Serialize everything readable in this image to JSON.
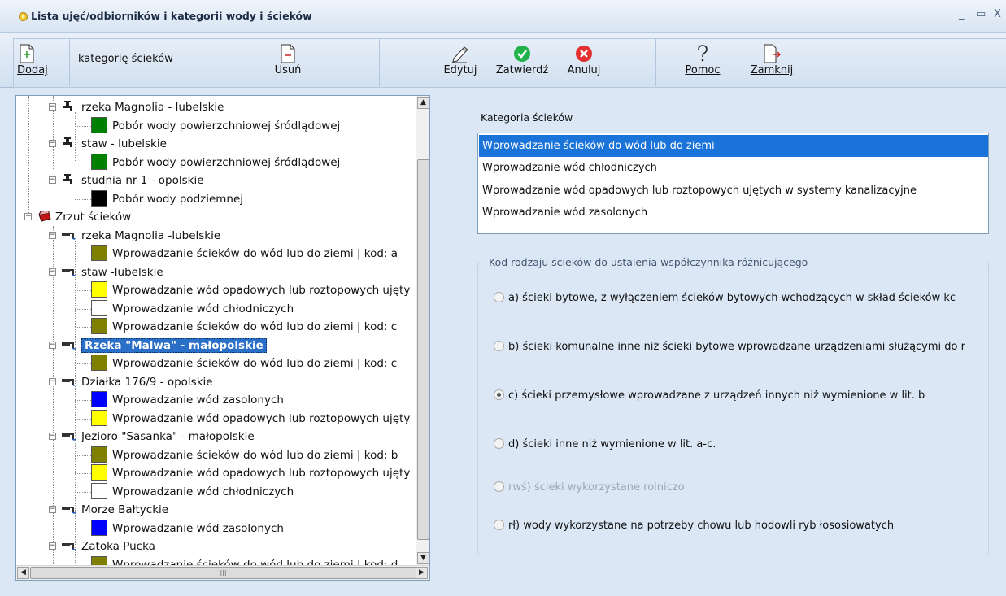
{
  "window": {
    "title": "Lista ujęć/odbiorników i kategorii wody i ścieków",
    "minimize": "_",
    "maximize": "▭",
    "close": "X"
  },
  "toolbar": {
    "add_label": "Dodaj",
    "add_hint": "kategorię ścieków",
    "delete_label": "Usuń",
    "edit_label": "Edytuj",
    "confirm_label": "Zatwierdź",
    "cancel_label": "Anuluj",
    "help_label": "Pomoc",
    "close_label": "Zamknij"
  },
  "tree": {
    "nodes": [
      {
        "text": "rzeka Magnolia - lubelskie",
        "kind": "intake"
      },
      {
        "text": "Pobór wody powierzchniowej śródlądowej",
        "color": "#008000"
      },
      {
        "text": "staw - lubelskie",
        "kind": "intake"
      },
      {
        "text": "Pobór wody powierzchniowej śródlądowej",
        "color": "#008000"
      },
      {
        "text": "studnia nr 1 - opolskie",
        "kind": "intake"
      },
      {
        "text": "Pobór wody podziemnej",
        "color": "#000000"
      },
      {
        "text": "Zrzut ścieków",
        "kind": "root"
      },
      {
        "text": "rzeka Magnolia -lubelskie",
        "kind": "receiver"
      },
      {
        "text": "Wprowadzanie ścieków do wód lub do ziemi | kod: a",
        "color": "#808000"
      },
      {
        "text": "staw -lubelskie",
        "kind": "receiver"
      },
      {
        "text": "Wprowadzanie wód opadowych lub roztopowych ujęty",
        "color": "#ffff00"
      },
      {
        "text": "Wprowadzanie wód chłodniczych",
        "color": "#ffffff"
      },
      {
        "text": "Wprowadzanie ścieków do wód lub do ziemi | kod: c",
        "color": "#808000"
      },
      {
        "text": "Rzeka \"Malwa\" - małopolskie",
        "kind": "receiver",
        "selected": true
      },
      {
        "text": "Wprowadzanie ścieków do wód lub do ziemi | kod: c",
        "color": "#808000"
      },
      {
        "text": "Działka 176/9 - opolskie",
        "kind": "receiver"
      },
      {
        "text": "Wprowadzanie wód zasolonych",
        "color": "#0000ff"
      },
      {
        "text": "Wprowadzanie wód opadowych lub roztopowych ujęty",
        "color": "#ffff00"
      },
      {
        "text": "Jezioro \"Sasanka\" - małopolskie",
        "kind": "receiver"
      },
      {
        "text": "Wprowadzanie ścieków do wód lub do ziemi | kod: b",
        "color": "#808000"
      },
      {
        "text": "Wprowadzanie wód opadowych lub roztopowych ujęty",
        "color": "#ffff00"
      },
      {
        "text": "Wprowadzanie wód chłodniczych",
        "color": "#ffffff"
      },
      {
        "text": "Morze Bałtyckie",
        "kind": "receiver"
      },
      {
        "text": "Wprowadzanie wód zasolonych",
        "color": "#0000ff"
      },
      {
        "text": "Zatoka Pucka",
        "kind": "receiver"
      },
      {
        "text": "Wprowadzanie ścieków do wód lub do ziemi | kod: d",
        "color": "#808000"
      }
    ]
  },
  "category": {
    "label": "Kategoria ścieków",
    "items": [
      "Wprowadzanie ścieków do wód lub do ziemi",
      "Wprowadzanie wód chłodniczych",
      "Wprowadzanie wód opadowych lub roztopowych ujętych w systemy kanalizacyjne",
      "Wprowadzanie wód zasolonych"
    ],
    "selected_index": 0
  },
  "code": {
    "title": "Kod rodzaju ścieków do ustalenia współczynnika różnicującego",
    "options": [
      {
        "text": "a) ścieki bytowe, z wyłączeniem ścieków bytowych wchodzących w skład ścieków kc",
        "checked": false,
        "disabled": false
      },
      {
        "text": "b) ścieki komunalne inne niż ścieki bytowe wprowadzane urządzeniami służącymi do r",
        "checked": false,
        "disabled": false
      },
      {
        "text": "c) ścieki przemysłowe wprowadzane z urządzeń innych niż wymienione w lit. b",
        "checked": true,
        "disabled": false
      },
      {
        "text": "d) ścieki inne niż wymienione w lit. a-c.",
        "checked": false,
        "disabled": false
      },
      {
        "text": "rwś) ścieki wykorzystane rolniczo",
        "checked": false,
        "disabled": true
      },
      {
        "text": "rł) wody wykorzystane na potrzeby chowu lub hodowli ryb łososiowatych",
        "checked": false,
        "disabled": false
      }
    ]
  },
  "colors": {
    "selection": "#1a73d8",
    "tree_selection": "#2a70c8",
    "background": "#dbe7f5"
  }
}
